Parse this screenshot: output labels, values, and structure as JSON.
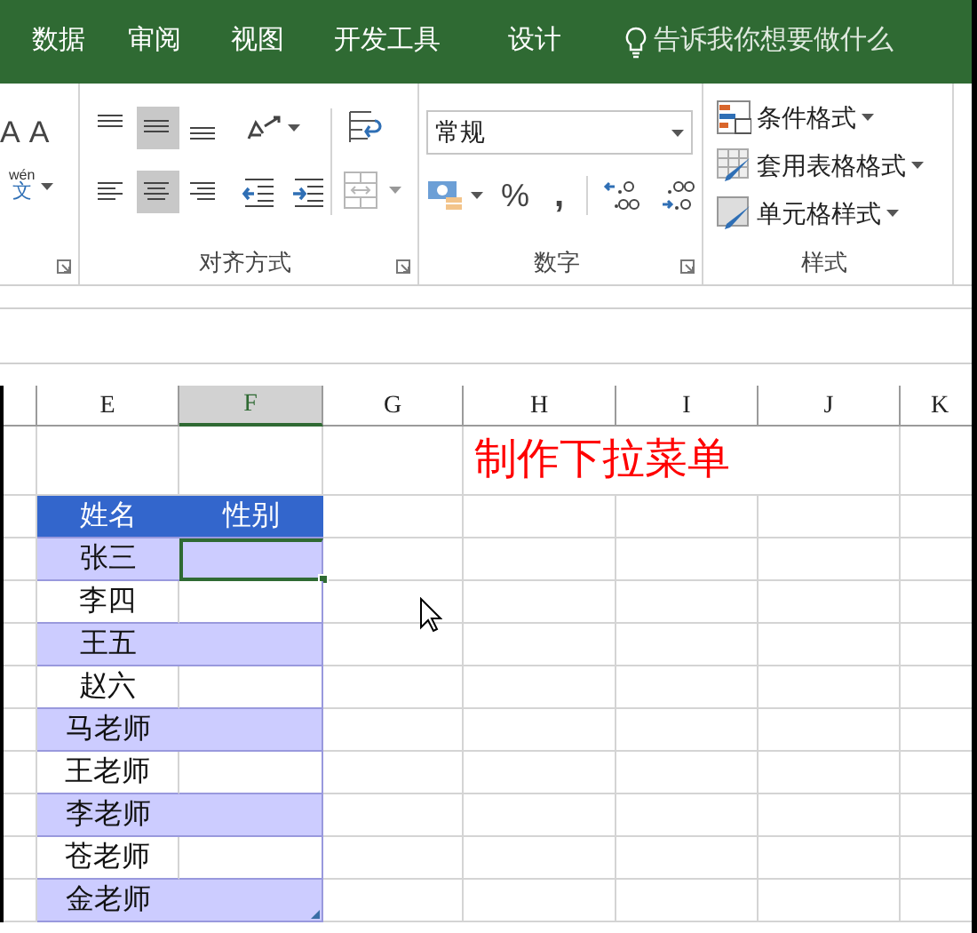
{
  "menu_tabs": [
    {
      "label": "数据"
    },
    {
      "label": "审阅"
    },
    {
      "label": "视图"
    },
    {
      "label": "开发工具"
    },
    {
      "label": "设计"
    }
  ],
  "tell_me": {
    "placeholder": "告诉我你想要做什么"
  },
  "ribbon": {
    "font_partial": {
      "grow": "A",
      "shrink": "A",
      "phonetic_top": "wén",
      "phonetic": "文"
    },
    "alignment": {
      "label": "对齐方式",
      "vertical": [
        {
          "kind": "top",
          "selected": false
        },
        {
          "kind": "middle",
          "selected": true
        },
        {
          "kind": "bottom",
          "selected": false
        }
      ],
      "horizontal": [
        {
          "kind": "left",
          "selected": false
        },
        {
          "kind": "center",
          "selected": true
        },
        {
          "kind": "right",
          "selected": false
        }
      ]
    },
    "number": {
      "label": "数字",
      "format": "常规",
      "percent": "%",
      "comma": ","
    },
    "styles": {
      "label": "样式",
      "buttons": [
        {
          "kind": "conditional",
          "label": "条件格式"
        },
        {
          "kind": "table",
          "label": "套用表格格式"
        },
        {
          "kind": "cell",
          "label": "单元格样式"
        }
      ]
    }
  },
  "sheet": {
    "columns": [
      {
        "label": "E",
        "selected": false
      },
      {
        "label": "F",
        "selected": true
      },
      {
        "label": "G",
        "selected": false
      },
      {
        "label": "H",
        "selected": false
      },
      {
        "label": "I",
        "selected": false
      },
      {
        "label": "J",
        "selected": false
      },
      {
        "label": "K",
        "selected": false
      }
    ],
    "title": "制作下拉菜单",
    "table": {
      "headers": [
        "姓名",
        "性别"
      ],
      "rows": [
        {
          "name": "张三",
          "banded": true,
          "selected": true
        },
        {
          "name": "李四",
          "banded": false,
          "selected": false
        },
        {
          "name": "王五",
          "banded": true,
          "selected": false
        },
        {
          "name": "赵六",
          "banded": false,
          "selected": false
        },
        {
          "name": "马老师",
          "banded": true,
          "selected": false
        },
        {
          "name": "王老师",
          "banded": false,
          "selected": false
        },
        {
          "name": "李老师",
          "banded": true,
          "selected": false
        },
        {
          "name": "苍老师",
          "banded": false,
          "selected": false
        },
        {
          "name": "金老师",
          "banded": true,
          "selected": false
        }
      ]
    }
  }
}
